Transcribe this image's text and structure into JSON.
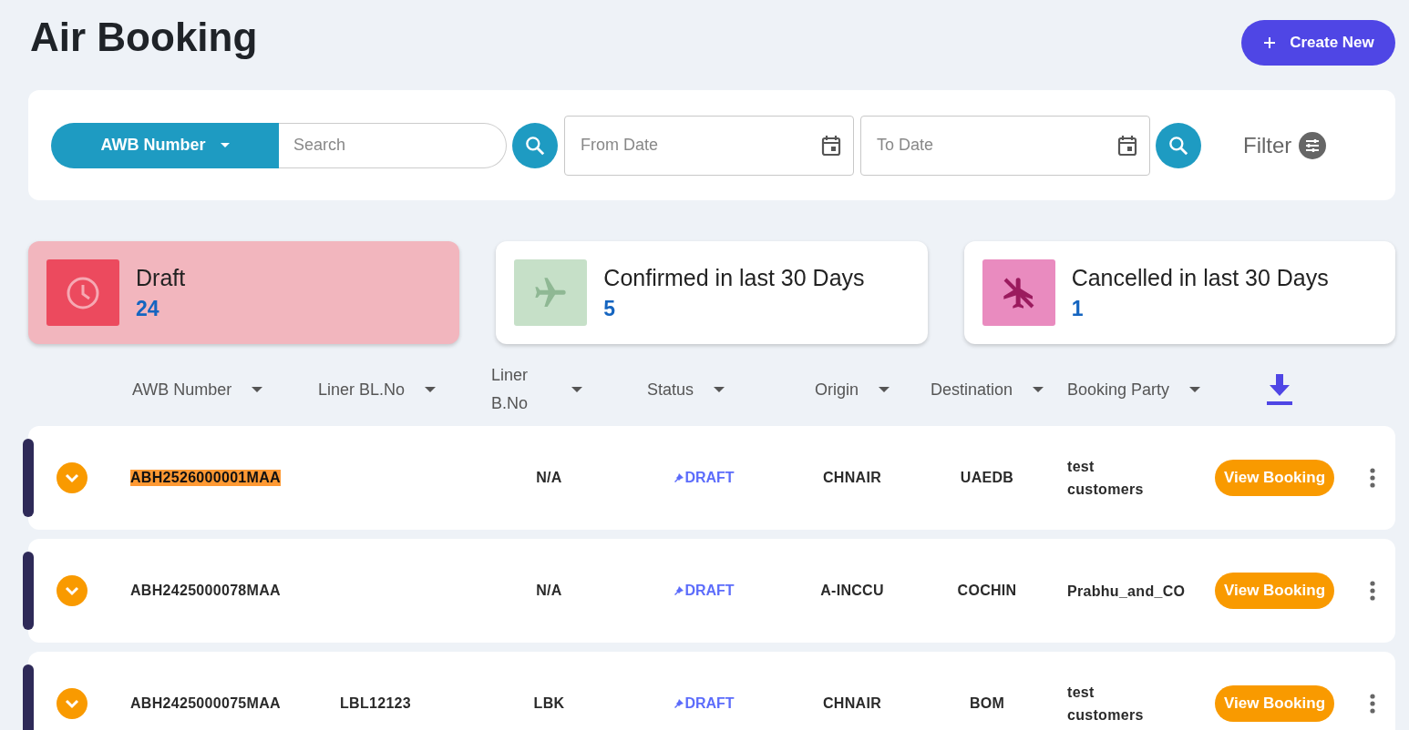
{
  "page": {
    "title": "Air Booking",
    "create_button": "Create New"
  },
  "search_bar": {
    "search_by": "AWB Number",
    "placeholder": "Search",
    "from_date": {
      "placeholder": "From Date"
    },
    "to_date": {
      "placeholder": "To Date"
    },
    "filter_label": "Filter"
  },
  "stats": [
    {
      "kind": "draft",
      "label": "Draft",
      "count": "24",
      "selected": true
    },
    {
      "kind": "confirmed",
      "label": "Confirmed in last 30 Days",
      "count": "5",
      "selected": false
    },
    {
      "kind": "cancelled",
      "label": "Cancelled in last 30 Days",
      "count": "1",
      "selected": false
    }
  ],
  "columns": [
    {
      "label": "AWB Number"
    },
    {
      "label": "Liner BL.No"
    },
    {
      "label": "Liner B.No"
    },
    {
      "label": "Status"
    },
    {
      "label": "Origin"
    },
    {
      "label": "Destination"
    },
    {
      "label": "Booking Party"
    }
  ],
  "rows": [
    {
      "awb": "ABH2526000001MAA",
      "highlighted": true,
      "liner_b_no": "N/A",
      "status": "DRAFT",
      "origin": "CHNAIR",
      "destination": "UAEDB",
      "booking_party": "test customers",
      "action": "View Booking"
    },
    {
      "awb": "ABH2425000078MAA",
      "highlighted": false,
      "liner_b_no": "N/A",
      "status": "DRAFT",
      "origin": "A-INCCU",
      "destination": "COCHIN",
      "booking_party": "Prabhu_and_CO",
      "action": "View Booking"
    },
    {
      "awb": "ABH2425000075MAA",
      "highlighted": false,
      "liner_bl": "LBL12123",
      "liner_b_no": "LBK",
      "status": "DRAFT",
      "origin": "CHNAIR",
      "destination": "BOM",
      "booking_party": "test customers",
      "action": "View Booking"
    }
  ]
}
